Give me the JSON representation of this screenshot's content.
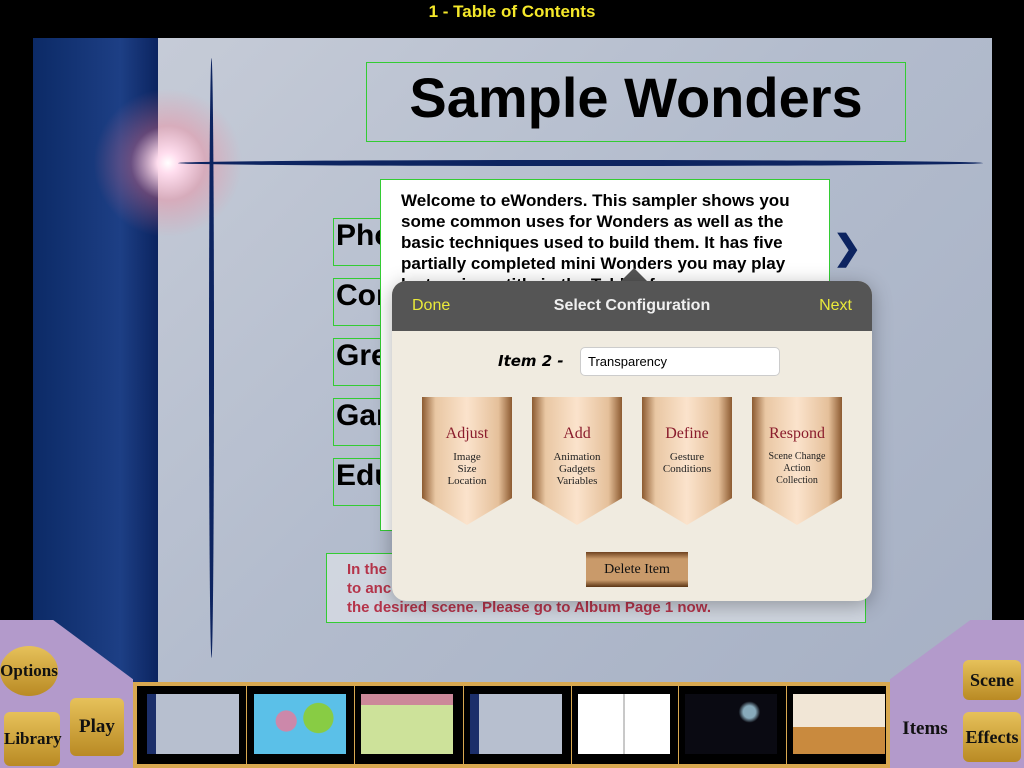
{
  "window": {
    "title": "1 - Table of Contents"
  },
  "slide": {
    "heading": "Sample Wonders",
    "menu_items": [
      "Pho",
      "Com",
      "Gre",
      "Gam",
      "Edu"
    ],
    "welcome_text": "Welcome to eWonders.  This sampler shows you some common uses for Wonders as well as the basic techniques used to build them.  It has five partially completed mini Wonders you may play by tapping a title in the Table of",
    "note_text": [
      "In the",
      "to anc",
      "the desired scene.  Please go to Album Page 1 now."
    ],
    "next_glyph": "❯"
  },
  "popover": {
    "done": "Done",
    "title": "Select Configuration",
    "next": "Next",
    "item_label": "Item 2 -",
    "item_value": "Transparency",
    "banners": [
      {
        "title": "Adjust",
        "lines": [
          "Image",
          "Size",
          "Location"
        ]
      },
      {
        "title": "Add",
        "lines": [
          "Animation",
          "Gadgets",
          "Variables"
        ]
      },
      {
        "title": "Define",
        "lines": [
          "Gesture",
          "Conditions"
        ]
      },
      {
        "title": "Respond",
        "lines": [
          "Scene Change",
          "Action",
          "Collection"
        ]
      }
    ],
    "delete": "Delete Item"
  },
  "toolbar": {
    "options": "Options",
    "library": "Library",
    "play": "Play",
    "items": "Items",
    "scene": "Scene",
    "effects": "Effects"
  },
  "colors": {
    "title": "#f5e82a",
    "accent": "#eaea3a",
    "note": "#b5344a"
  }
}
